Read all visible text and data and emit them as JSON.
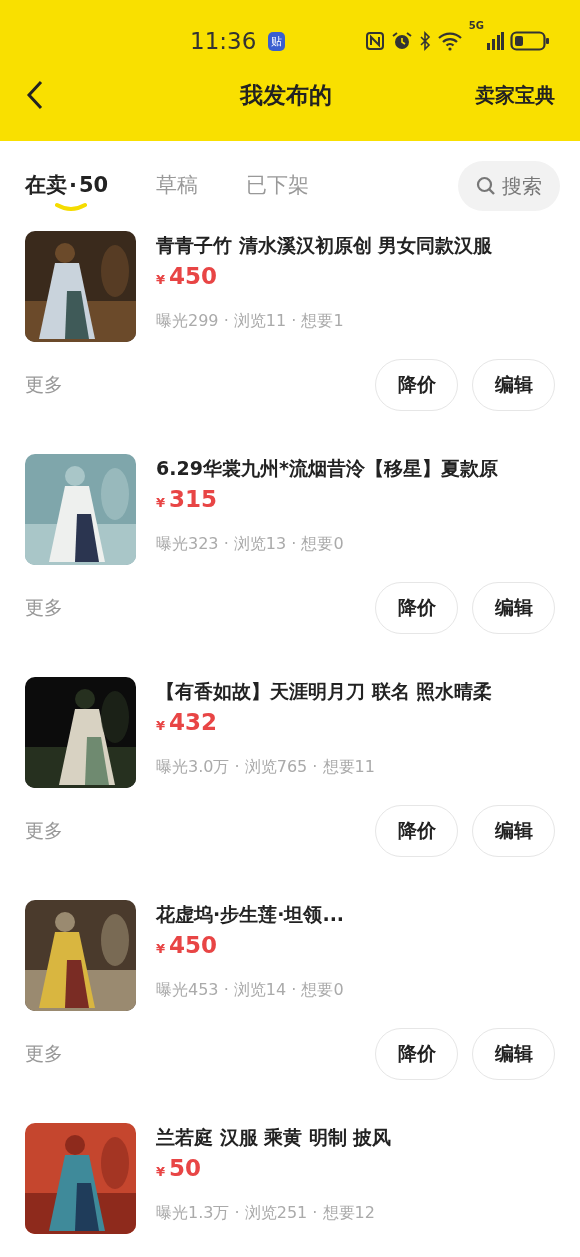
{
  "status_bar": {
    "time": "11:36",
    "app_badge": "贴",
    "network": "5G"
  },
  "header": {
    "title": "我发布的",
    "action": "卖家宝典"
  },
  "tabs": [
    {
      "label": "在卖",
      "separator": "·",
      "count": "50",
      "selected": true
    },
    {
      "label": "草稿",
      "selected": false
    },
    {
      "label": "已下架",
      "selected": false
    }
  ],
  "search": {
    "label": "搜索"
  },
  "items": [
    {
      "title": "青青子竹 清水溪汉初原创 男女同款汉服",
      "currency": "¥",
      "price": "450",
      "stats": "曝光299 · 浏览11 · 想要1",
      "more": "更多",
      "buttons": [
        "降价",
        "编辑"
      ],
      "kind": "picture"
    },
    {
      "title": "6.29华裳九州*流烟昔泠【移星】夏款原",
      "currency": "¥",
      "price": "315",
      "stats": "曝光323 · 浏览13 · 想要0",
      "more": "更多",
      "buttons": [
        "降价",
        "编辑"
      ],
      "kind": "picture"
    },
    {
      "title": "【有香如故】天涯明月刀 联名 照水晴柔",
      "currency": "¥",
      "price": "432",
      "stats": "曝光3.0万 · 浏览765 · 想要11",
      "more": "更多",
      "buttons": [
        "降价",
        "编辑"
      ],
      "kind": "picture"
    },
    {
      "title": "花虚坞·步生莲·坦领...",
      "currency": "¥",
      "price": "450",
      "stats": "曝光453 · 浏览14 · 想要0",
      "more": "更多",
      "buttons": [
        "降价",
        "编辑"
      ],
      "kind": "picture"
    },
    {
      "title": "兰若庭 汉服 乘黄 明制 披风",
      "currency": "¥",
      "price": "50",
      "stats": "曝光1.3万 · 浏览251 · 想要12",
      "kind": "picture"
    }
  ]
}
